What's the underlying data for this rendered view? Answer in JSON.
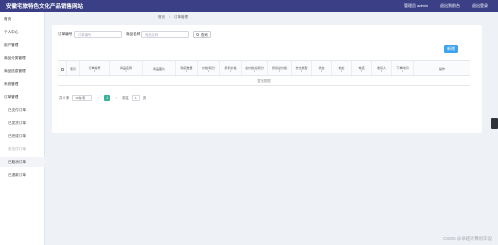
{
  "header": {
    "title": "安徽宅旅特色文化产品销售网站",
    "links": [
      "管理员 admin",
      "退出到前台",
      "退出登录"
    ],
    "bg_color": "#3a3f86"
  },
  "sidebar": {
    "items": [
      {
        "label": "首页"
      },
      {
        "label": "个人中心"
      },
      {
        "label": "用户管理"
      },
      {
        "label": "商品分类管理"
      },
      {
        "label": "商品信息管理"
      },
      {
        "label": "系统管理"
      },
      {
        "label": "订单管理"
      },
      {
        "label": "已支付订单"
      },
      {
        "label": "已发货订单"
      },
      {
        "label": "已完成订单"
      },
      {
        "label": "未支付订单"
      },
      {
        "label": "已取消订单"
      },
      {
        "label": "已退款订单"
      }
    ]
  },
  "breadcrumb": {
    "home": "首页",
    "current": "订单管理"
  },
  "filters": {
    "order_no_label": "订单编号",
    "order_no_placeholder": "订单编号",
    "product_label": "商品名称",
    "product_placeholder": "商品名称",
    "search_label": "查询"
  },
  "actions": {
    "add_label": "新增",
    "accent_color": "#3ea3f0"
  },
  "table": {
    "columns": [
      {
        "label": "",
        "type": "checkbox"
      },
      {
        "label": "索引"
      },
      {
        "label": "订单编号",
        "sortable": true
      },
      {
        "label": "商品名称",
        "sortable": true
      },
      {
        "label": "商品图片"
      },
      {
        "label": "购买数量",
        "sortable": true
      },
      {
        "label": "价格/积分",
        "sortable": true
      },
      {
        "label": "折扣价格",
        "sortable": true
      },
      {
        "label": "总价格/总积分",
        "sortable": true
      },
      {
        "label": "折扣总价格",
        "sortable": true
      },
      {
        "label": "支付类型",
        "sortable": true
      },
      {
        "label": "状态",
        "sortable": true
      },
      {
        "label": "地址",
        "sortable": true
      },
      {
        "label": "电话",
        "sortable": true
      },
      {
        "label": "收货人",
        "sortable": true
      },
      {
        "label": "下单时间",
        "sortable": true
      },
      {
        "label": "操作"
      }
    ],
    "empty_text": "暂无数据",
    "sort_glyph": "⇕"
  },
  "pagination": {
    "total_text": "共 0 条",
    "page_size": "10条/页",
    "current_page": "1",
    "goto_label": "前往",
    "goto_value": "1",
    "page_suffix": "页",
    "prev_glyph": "‹",
    "next_glyph": "›",
    "accent_color": "#3ab19b"
  },
  "watermark": "CSDN @卓越计算机毕设"
}
